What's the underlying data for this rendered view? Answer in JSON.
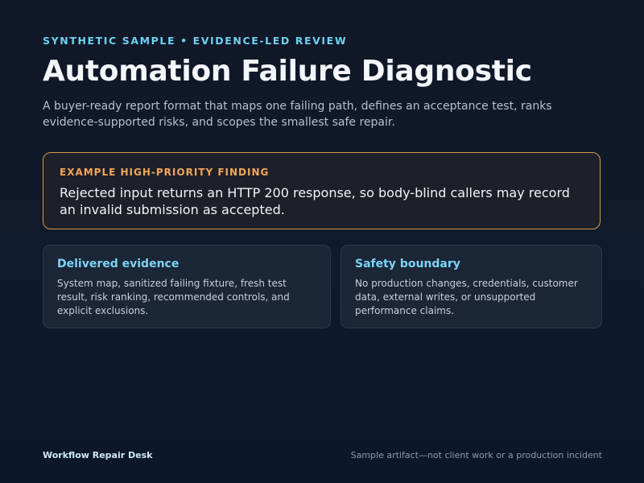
{
  "header": {
    "eyebrow": "SYNTHETIC SAMPLE • EVIDENCE-LED REVIEW",
    "title": "Automation Failure Diagnostic",
    "subtitle": "A buyer-ready report format that maps one failing path, defines an acceptance test, ranks evidence-supported risks, and scopes the smallest safe repair."
  },
  "finding": {
    "label": "EXAMPLE HIGH-PRIORITY FINDING",
    "text": "Rejected input returns an HTTP 200 response, so body-blind callers may record an invalid submission as accepted."
  },
  "cards": [
    {
      "title": "Delivered evidence",
      "text": "System map, sanitized failing fixture, fresh test result, risk ranking, recommended controls, and explicit exclusions."
    },
    {
      "title": "Safety boundary",
      "text": "No production changes, credentials, customer data, external writes, or unsupported performance claims."
    }
  ],
  "footer": {
    "brand": "Workflow Repair Desk",
    "note": "Sample artifact—not client work or a production incident"
  },
  "colors": {
    "background": "#111827",
    "eyebrow_accent": "#6fd0f0",
    "finding_border": "#d59a4f",
    "finding_label": "#f0a65a",
    "card_title": "#7dd3f5"
  }
}
